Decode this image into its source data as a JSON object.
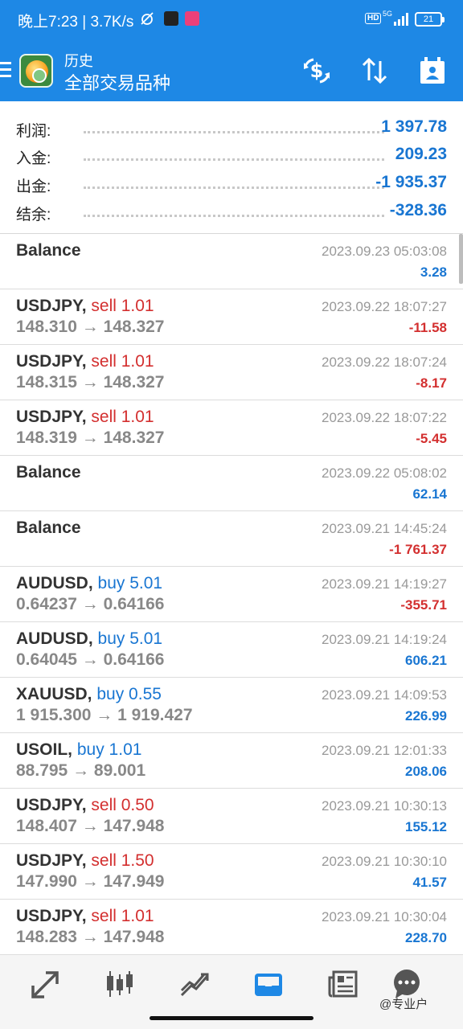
{
  "status_bar": {
    "time": "晚上7:23 | 3.7K/s",
    "hd": "HD",
    "network": "5G",
    "battery": "21"
  },
  "header": {
    "title_small": "历史",
    "title_big": "全部交易品种"
  },
  "summary": [
    {
      "label": "利润:",
      "value": "1 397.78"
    },
    {
      "label": "入金:",
      "value": "209.23"
    },
    {
      "label": "出金:",
      "value": "-1 935.37"
    },
    {
      "label": "结余:",
      "value": "-328.36"
    }
  ],
  "rows": [
    {
      "symbol": "Balance",
      "side": "",
      "prices": "",
      "date": "2023.09.23 05:03:08",
      "profit": "3.28",
      "positive": true
    },
    {
      "symbol": "USDJPY,",
      "side": "sell 1.01",
      "side_type": "sell",
      "prices": "148.310 → 148.327",
      "date": "2023.09.22 18:07:27",
      "profit": "-11.58",
      "positive": false
    },
    {
      "symbol": "USDJPY,",
      "side": "sell 1.01",
      "side_type": "sell",
      "prices": "148.315 → 148.327",
      "date": "2023.09.22 18:07:24",
      "profit": "-8.17",
      "positive": false
    },
    {
      "symbol": "USDJPY,",
      "side": "sell 1.01",
      "side_type": "sell",
      "prices": "148.319 → 148.327",
      "date": "2023.09.22 18:07:22",
      "profit": "-5.45",
      "positive": false
    },
    {
      "symbol": "Balance",
      "side": "",
      "prices": "",
      "date": "2023.09.22 05:08:02",
      "profit": "62.14",
      "positive": true
    },
    {
      "symbol": "Balance",
      "side": "",
      "prices": "",
      "date": "2023.09.21 14:45:24",
      "profit": "-1 761.37",
      "positive": false
    },
    {
      "symbol": "AUDUSD,",
      "side": "buy 5.01",
      "side_type": "buy",
      "prices": "0.64237 → 0.64166",
      "date": "2023.09.21 14:19:27",
      "profit": "-355.71",
      "positive": false
    },
    {
      "symbol": "AUDUSD,",
      "side": "buy 5.01",
      "side_type": "buy",
      "prices": "0.64045 → 0.64166",
      "date": "2023.09.21 14:19:24",
      "profit": "606.21",
      "positive": true
    },
    {
      "symbol": "XAUUSD,",
      "side": "buy 0.55",
      "side_type": "buy",
      "prices": "1 915.300 → 1 919.427",
      "date": "2023.09.21 14:09:53",
      "profit": "226.99",
      "positive": true
    },
    {
      "symbol": "USOIL,",
      "side": "buy 1.01",
      "side_type": "buy",
      "prices": "88.795 → 89.001",
      "date": "2023.09.21 12:01:33",
      "profit": "208.06",
      "positive": true
    },
    {
      "symbol": "USDJPY,",
      "side": "sell 0.50",
      "side_type": "sell",
      "prices": "148.407 → 147.948",
      "date": "2023.09.21 10:30:13",
      "profit": "155.12",
      "positive": true
    },
    {
      "symbol": "USDJPY,",
      "side": "sell 1.50",
      "side_type": "sell",
      "prices": "147.990 → 147.949",
      "date": "2023.09.21 10:30:10",
      "profit": "41.57",
      "positive": true
    },
    {
      "symbol": "USDJPY,",
      "side": "sell 1.01",
      "side_type": "sell",
      "prices": "148.283 → 147.948",
      "date": "2023.09.21 10:30:04",
      "profit": "228.70",
      "positive": true
    }
  ],
  "bottom_nav": {
    "icons": [
      "quotes-arrows-icon",
      "chart-candles-icon",
      "trade-chart-icon",
      "history-inbox-icon",
      "news-icon",
      "chat-icon"
    ],
    "active": "history-inbox-icon"
  },
  "watermark": "@专业户",
  "colors": {
    "header": "#1e88e5",
    "positive": "#1976d2",
    "negative": "#d32f2f",
    "active_nav": "#1e88e5"
  }
}
